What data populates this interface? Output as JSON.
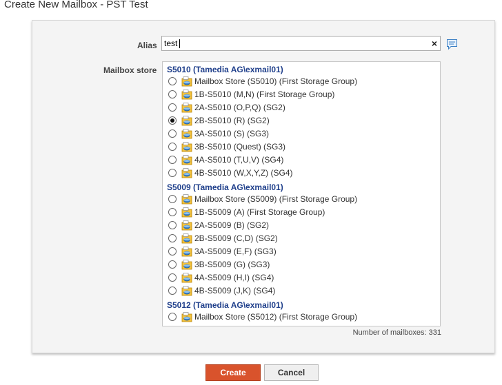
{
  "page": {
    "title": "Create New Mailbox - PST Test"
  },
  "alias": {
    "label": "Alias",
    "value": "test",
    "clear_icon": "×"
  },
  "mailbox_store": {
    "label": "Mailbox store",
    "selected": "2B-S5010 (R) (SG2)",
    "groups": [
      {
        "header": "S5010 (Tamedia AG\\exmail01)",
        "stores": [
          "Mailbox Store (S5010) (First Storage Group)",
          "1B-S5010 (M,N) (First Storage Group)",
          "2A-S5010 (O,P,Q) (SG2)",
          "2B-S5010 (R) (SG2)",
          "3A-S5010 (S) (SG3)",
          "3B-S5010 (Quest) (SG3)",
          "4A-S5010 (T,U,V) (SG4)",
          "4B-S5010 (W,X,Y,Z) (SG4)"
        ]
      },
      {
        "header": "S5009 (Tamedia AG\\exmail01)",
        "stores": [
          "Mailbox Store (S5009) (First Storage Group)",
          "1B-S5009 (A) (First Storage Group)",
          "2A-S5009 (B) (SG2)",
          "2B-S5009 (C,D) (SG2)",
          "3A-S5009 (E,F) (SG3)",
          "3B-S5009 (G) (SG3)",
          "4A-S5009 (H,I) (SG4)",
          "4B-S5009 (J,K) (SG4)"
        ]
      },
      {
        "header": "S5012 (Tamedia AG\\exmail01)",
        "stores": [
          "Mailbox Store (S5012) (First Storage Group)"
        ]
      }
    ],
    "count_text": "Number of mailboxes: 331"
  },
  "buttons": {
    "create": "Create",
    "cancel": "Cancel"
  },
  "colors": {
    "accent": "#d9532c",
    "group_header": "#1f3f8b"
  }
}
